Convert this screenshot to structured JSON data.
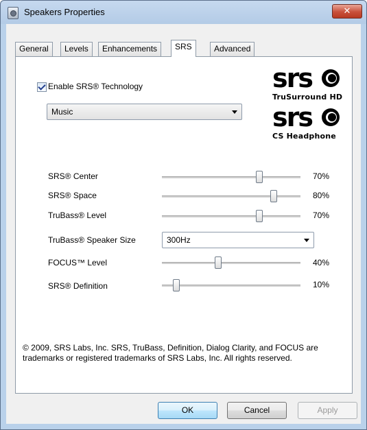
{
  "window": {
    "title": "Speakers Properties",
    "close_glyph": "✕"
  },
  "tabs": [
    {
      "label": "General",
      "selected": false
    },
    {
      "label": "Levels",
      "selected": false
    },
    {
      "label": "Enhancements",
      "selected": false
    },
    {
      "label": "SRS",
      "selected": true
    },
    {
      "label": "Advanced",
      "selected": false
    }
  ],
  "srs": {
    "enable_label": "Enable SRS® Technology",
    "enable_checked": true,
    "preset": {
      "value": "Music"
    },
    "logos": [
      {
        "mark": "srs",
        "subtitle": "TruSurround HD"
      },
      {
        "mark": "srs",
        "subtitle": "CS Headphone"
      }
    ],
    "controls": [
      {
        "label": "SRS® Center",
        "value_text": "70%",
        "value": 0.7
      },
      {
        "label": "SRS® Space",
        "value_text": "80%",
        "value": 0.8
      },
      {
        "label": "TruBass® Level",
        "value_text": "70%",
        "value": 0.7
      },
      {
        "label": "TruBass® Speaker Size",
        "select_value": "300Hz"
      },
      {
        "label": "FOCUS™ Level",
        "value_text": "40%",
        "value": 0.4
      },
      {
        "label": "SRS® Definition",
        "value_text": "10%",
        "value": 0.1
      }
    ],
    "copyright": "© 2009, SRS Labs, Inc.  SRS, TruBass, Definition, Dialog Clarity, and FOCUS are trademarks or registered trademarks of SRS Labs, Inc.  All rights reserved."
  },
  "buttons": {
    "ok": "OK",
    "cancel": "Cancel",
    "apply": "Apply"
  },
  "colors": {
    "accent": "#3c7fb1",
    "titlebar": "#b9d1ea",
    "close": "#c8503b"
  }
}
